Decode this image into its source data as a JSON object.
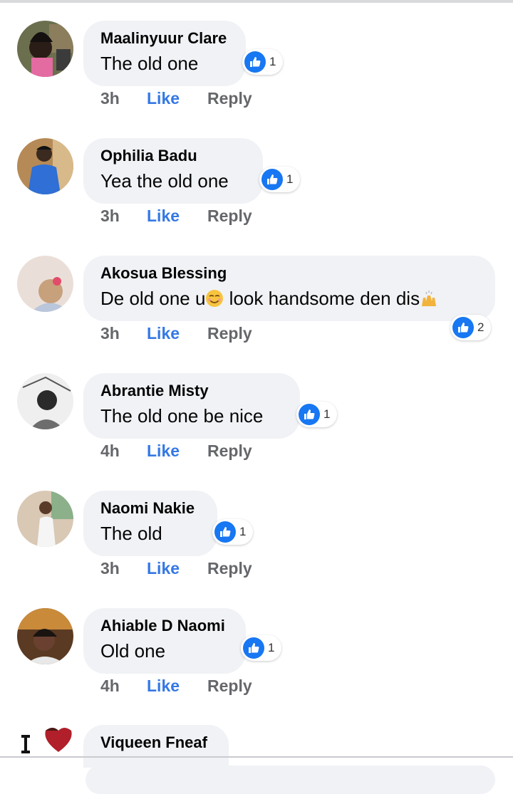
{
  "comments": [
    {
      "name": "Maalinyuur Clare",
      "text": "The old one",
      "time": "3h",
      "like_label": "Like",
      "reply_label": "Reply",
      "reaction_count": "1"
    },
    {
      "name": "Ophilia Badu",
      "text": "Yea the old one",
      "time": "3h",
      "like_label": "Like",
      "reply_label": "Reply",
      "reaction_count": "1"
    },
    {
      "name": "Akosua Blessing",
      "text_parts": [
        "De old one  u",
        " look handsome den dis"
      ],
      "time": "3h",
      "like_label": "Like",
      "reply_label": "Reply",
      "reaction_count": "2"
    },
    {
      "name": "Abrantie Misty",
      "text": "The old one be nice",
      "time": "4h",
      "like_label": "Like",
      "reply_label": "Reply",
      "reaction_count": "1"
    },
    {
      "name": "Naomi Nakie",
      "text": "The old",
      "time": "3h",
      "like_label": "Like",
      "reply_label": "Reply",
      "reaction_count": "1"
    },
    {
      "name": "Ahiable D Naomi",
      "text": "Old one",
      "time": "4h",
      "like_label": "Like",
      "reply_label": "Reply",
      "reaction_count": "1"
    },
    {
      "name": "Viqueen Fneaf"
    }
  ],
  "icons": {
    "reaction": "like-thumb-icon",
    "emoji_1": "smiling-face-icon",
    "emoji_2": "raising-hands-icon"
  },
  "colors": {
    "accent": "#3578e5",
    "reaction_blue": "#1877f2",
    "bubble": "#f0f2f5",
    "meta_gray": "#65676b"
  }
}
